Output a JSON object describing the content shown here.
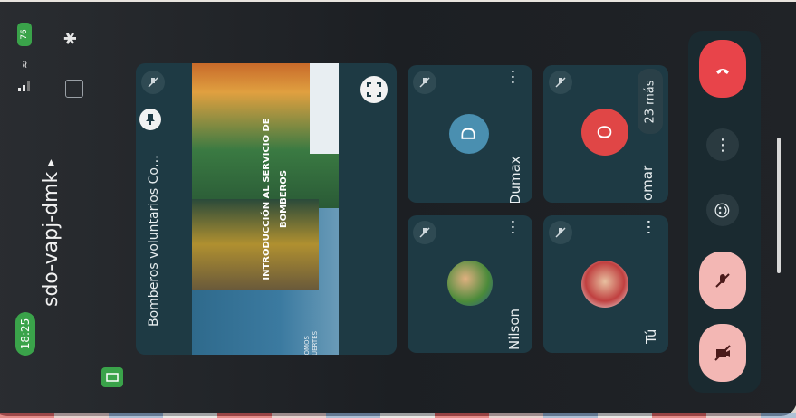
{
  "status_bar": {
    "time": "18:25",
    "battery": "76"
  },
  "header": {
    "meeting_code": "sdo-vapj-dmk"
  },
  "presentation": {
    "title": "Bomberos voluntarios Co…",
    "slide_heading": "INTRODUCCIÓN AL SERVICIO DE BOMBEROS",
    "slide_footer_line1": "SOMOS",
    "slide_footer_line2": "FUERTES"
  },
  "participants": [
    {
      "name": "Dumax",
      "initial": "D",
      "avatar_color": "#4a8fb0"
    },
    {
      "name": "omar",
      "initial": "O",
      "avatar_color": "#e04646"
    },
    {
      "name": "Nilson",
      "initial": "",
      "avatar_color": "#3a6e8a"
    },
    {
      "name": "Tú",
      "initial": "",
      "avatar_color": "#c8d6dc"
    }
  ],
  "more_participants": "23 más",
  "colors": {
    "tile_bg": "#1e3a44",
    "end_call": "#e8444a",
    "muted_control": "#f3b7b4",
    "status_green": "#3aa34a"
  },
  "icons": {
    "end_call": "phone-hangup-icon",
    "mic_off": "mic-off-icon",
    "camera_off": "camera-off-icon",
    "emoji": "emoji-icon",
    "more": "more-vert-icon",
    "fullscreen": "fullscreen-icon",
    "pin": "pin-icon"
  }
}
